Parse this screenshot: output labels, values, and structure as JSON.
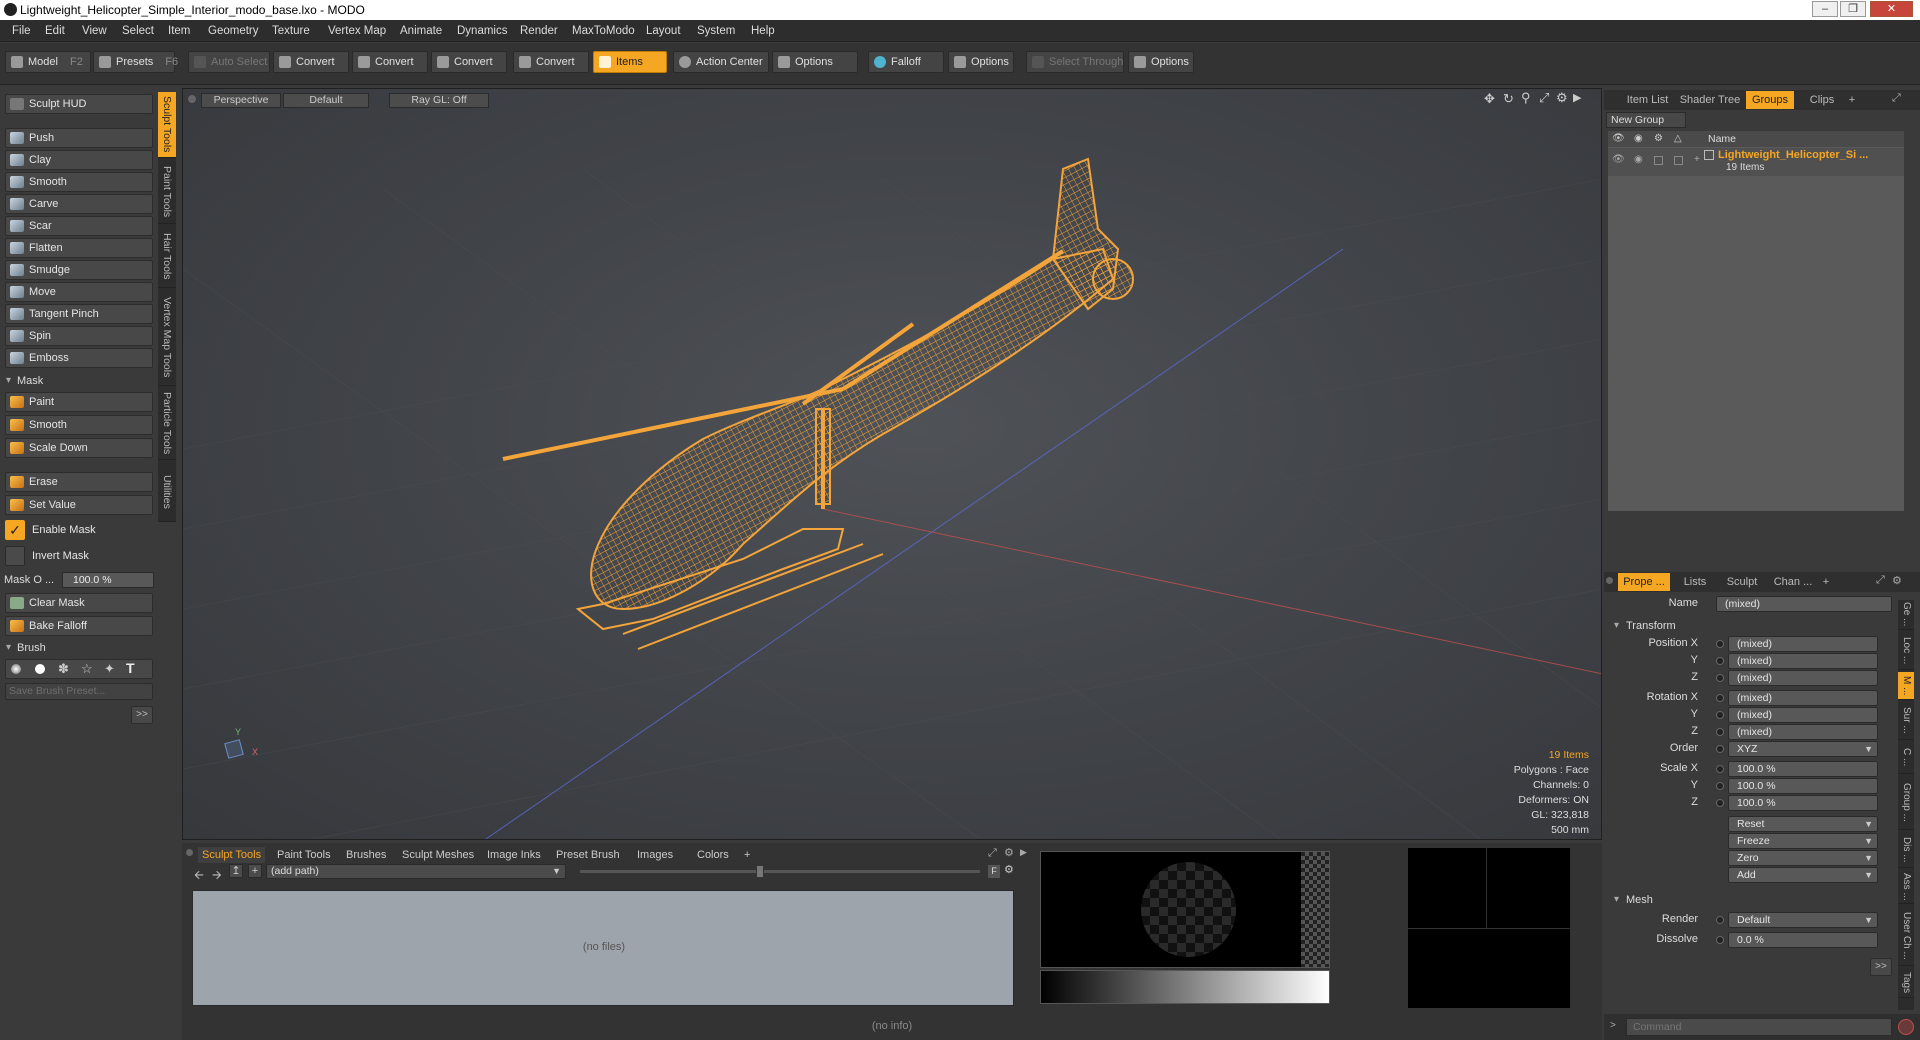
{
  "window": {
    "title": "Lightweight_Helicopter_Simple_Interior_modo_base.lxo - MODO"
  },
  "menu": [
    "File",
    "Edit",
    "View",
    "Select",
    "Item",
    "Geometry",
    "Texture",
    "Vertex Map",
    "Animate",
    "Dynamics",
    "Render",
    "MaxToModo",
    "Layout",
    "System",
    "Help"
  ],
  "toolbar": {
    "model": "Model",
    "model_key": "F2",
    "presets": "Presets",
    "presets_key": "F6",
    "auto_select": "Auto Select",
    "convert1": "Convert",
    "convert2": "Convert",
    "convert3": "Convert",
    "convert4": "Convert",
    "items": "Items",
    "action_center": "Action Center",
    "options1": "Options",
    "falloff": "Falloff",
    "options2": "Options",
    "select_through": "Select Through",
    "options3": "Options"
  },
  "left": {
    "hud": "Sculpt HUD",
    "tools": [
      "Push",
      "Clay",
      "Smooth",
      "Carve",
      "Scar",
      "Flatten",
      "Smudge",
      "Move",
      "Tangent Pinch",
      "Spin",
      "Emboss"
    ],
    "mask_section": "Mask",
    "mask_tools": [
      "Paint",
      "Smooth",
      "Scale Down"
    ],
    "erase": "Erase",
    "set_value": "Set Value",
    "enable_mask": "Enable Mask",
    "invert_mask": "Invert Mask",
    "mask_opacity_label": "Mask O ...",
    "mask_opacity_value": "100.0 %",
    "clear_mask": "Clear Mask",
    "bake_falloff": "Bake Falloff",
    "brush_section": "Brush",
    "save_brush": "Save Brush Preset...",
    "more": ">>",
    "vtabs": [
      "Sculpt Tools",
      "Paint Tools",
      "Hair Tools",
      "Vertex Map Tools",
      "Particle Tools",
      "Utilities"
    ]
  },
  "viewport": {
    "perspective": "Perspective",
    "default": "Default",
    "raygl": "Ray GL: Off",
    "stats": {
      "items": "19 Items",
      "polygons": "Polygons : Face",
      "channels": "Channels: 0",
      "deformers": "Deformers: ON",
      "gl": "GL: 323,818",
      "scale": "500 mm"
    },
    "axis_y": "Y",
    "axis_x": "X"
  },
  "bottom": {
    "tabs": [
      "Sculpt Tools",
      "Paint Tools",
      "Brushes",
      "Sculpt Meshes",
      "Image Inks",
      "Preset Brush",
      "Images",
      "Colors"
    ],
    "add_tab": "+",
    "path": "(add path)",
    "no_files": "(no files)",
    "f_btn": "F",
    "status": "(no info)"
  },
  "right": {
    "tabs": [
      "Item List",
      "Shader Tree",
      "Groups",
      "Clips"
    ],
    "add_tab": "+",
    "new_group": "New Group",
    "name_col": "Name",
    "group_name": "Lightweight_Helicopter_Si ...",
    "group_count": "19 Items",
    "prop_tabs": [
      "Prope ...",
      "Lists",
      "Sculpt",
      "Chan ..."
    ],
    "name_label": "Name",
    "name_value": "(mixed)",
    "transform": "Transform",
    "position_x": "Position X",
    "rotation_x": "Rotation X",
    "scale_x": "Scale X",
    "y": "Y",
    "z": "Z",
    "mixed": "(mixed)",
    "order_label": "Order",
    "order_value": "XYZ",
    "scale_value": "100.0 %",
    "reset": "Reset",
    "freeze": "Freeze",
    "zero": "Zero",
    "add": "Add",
    "mesh": "Mesh",
    "render_label": "Render",
    "render_value": "Default",
    "dissolve_label": "Dissolve",
    "dissolve_value": "0.0 %",
    "more": ">>",
    "vtabs": [
      "Ge ...",
      "Loc ...",
      "M ...",
      "Sur ...",
      "C ...",
      "Group ...",
      "Dis ...",
      "Ass ...",
      "User Ch ...",
      "Tags"
    ],
    "command_placeholder": "Command"
  },
  "colors": {
    "accent": "#f5a623",
    "wireframe": "#f3a43a"
  }
}
